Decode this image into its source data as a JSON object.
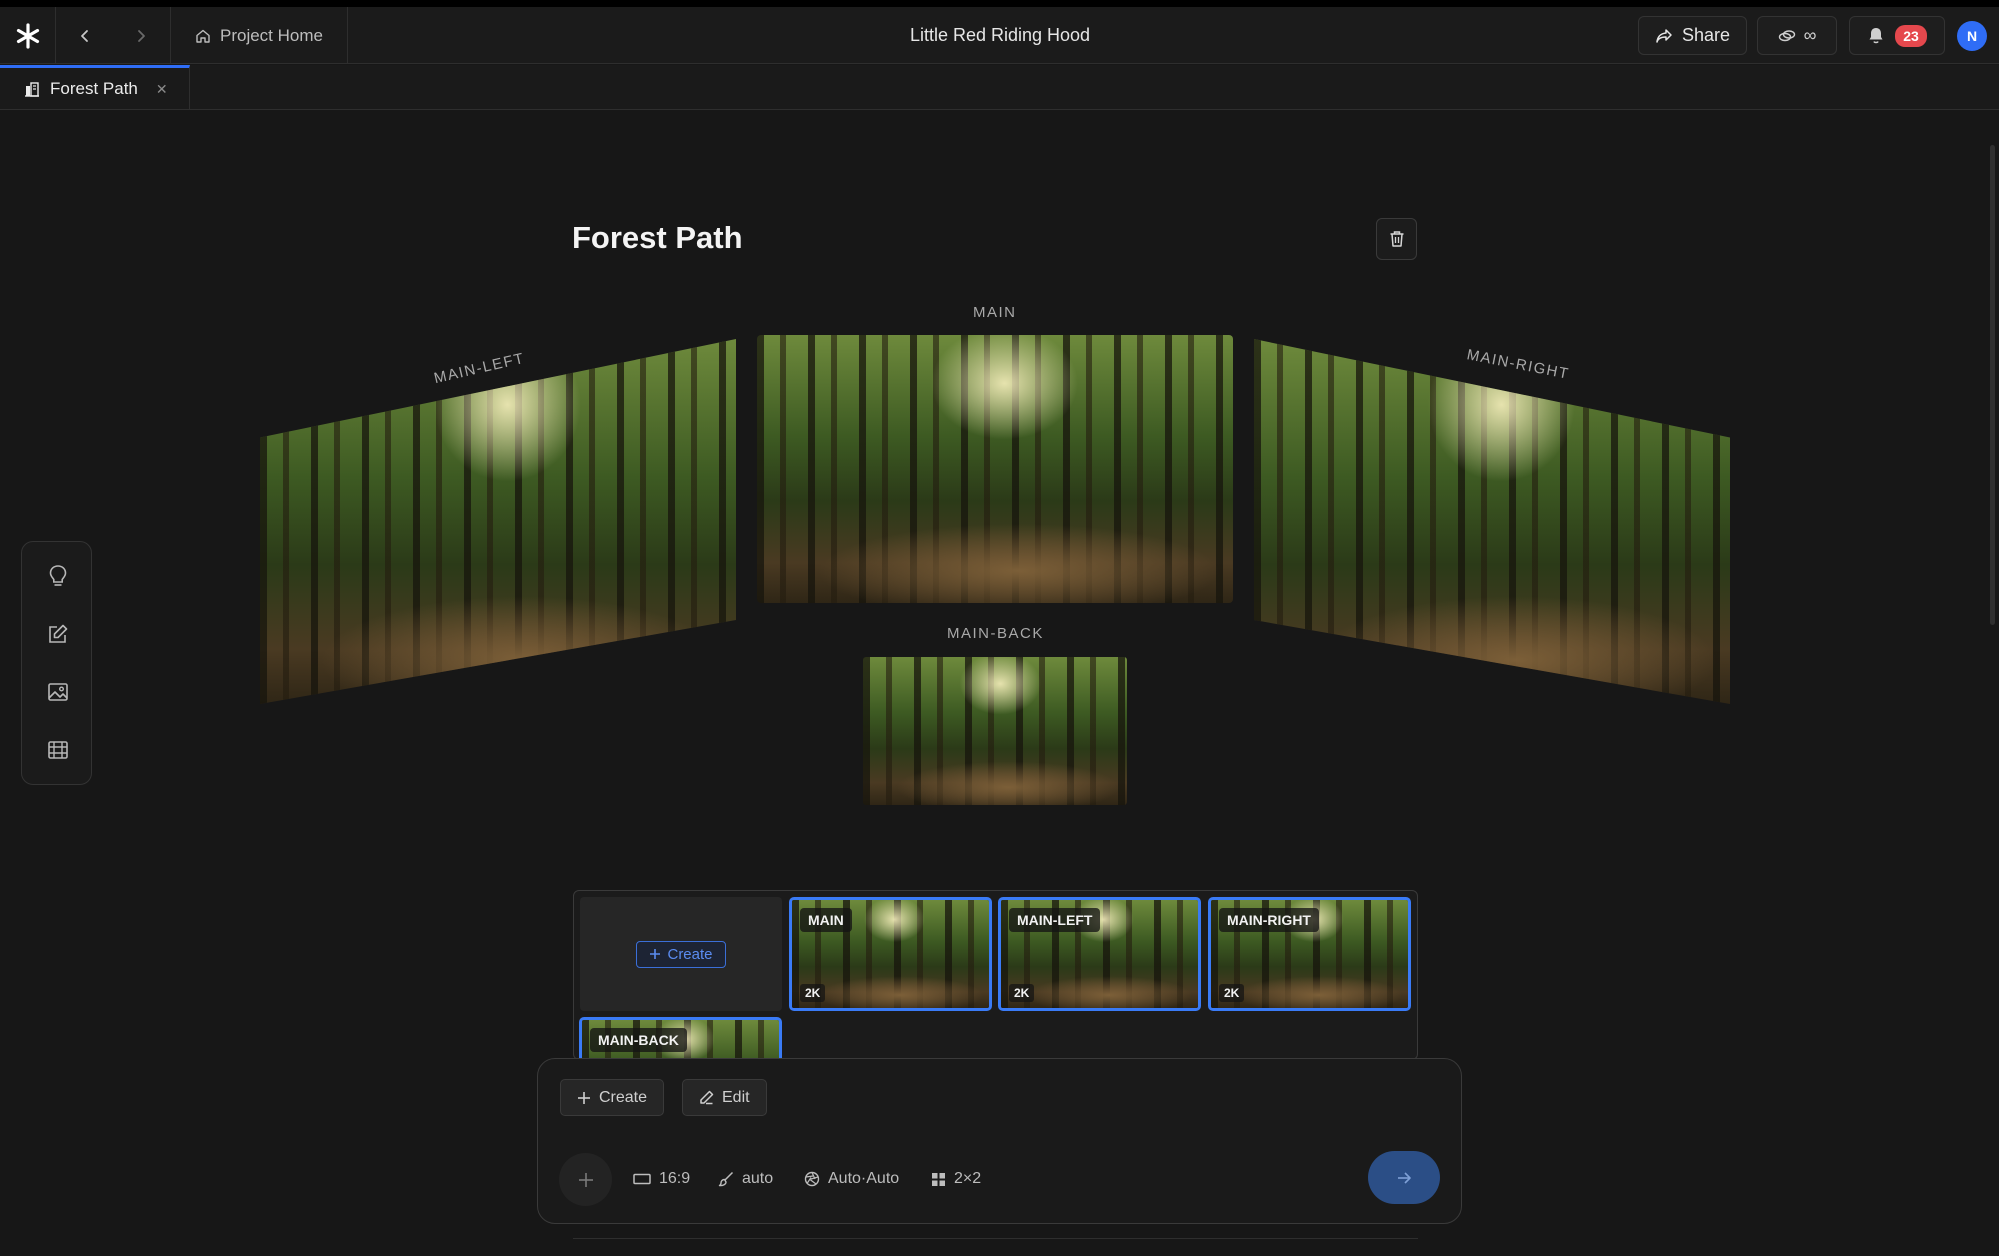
{
  "header": {
    "project_home_label": "Project Home",
    "title": "Little Red Riding Hood",
    "share_label": "Share",
    "credits_value": "∞",
    "notification_count": "23",
    "avatar_initial": "N"
  },
  "tabs": [
    {
      "label": "Forest Path",
      "active": true
    }
  ],
  "tool_rail": [
    {
      "icon": "lightbulb-icon"
    },
    {
      "icon": "edit-icon"
    },
    {
      "icon": "image-icon"
    },
    {
      "icon": "film-icon"
    }
  ],
  "scene": {
    "title": "Forest Path",
    "views": {
      "main": "MAIN",
      "left": "MAIN-LEFT",
      "right": "MAIN-RIGHT",
      "back": "MAIN-BACK"
    }
  },
  "gallery": {
    "create_label": "Create",
    "thumbnails": [
      {
        "label": "MAIN",
        "resolution": "2K"
      },
      {
        "label": "MAIN-LEFT",
        "resolution": "2K"
      },
      {
        "label": "MAIN-RIGHT",
        "resolution": "2K"
      },
      {
        "label": "MAIN-BACK",
        "resolution": ""
      }
    ]
  },
  "composer": {
    "modes": [
      {
        "label": "Create",
        "icon": "plus-icon"
      },
      {
        "label": "Edit",
        "icon": "pencil-icon"
      }
    ],
    "options": {
      "aspect_ratio": "16:9",
      "style": "auto",
      "model": "Auto·Auto",
      "grid": "2×2"
    }
  },
  "colors": {
    "background": "#171717",
    "accent": "#3a7bf6",
    "badge": "#e5484d",
    "send": "#2b4e86"
  }
}
